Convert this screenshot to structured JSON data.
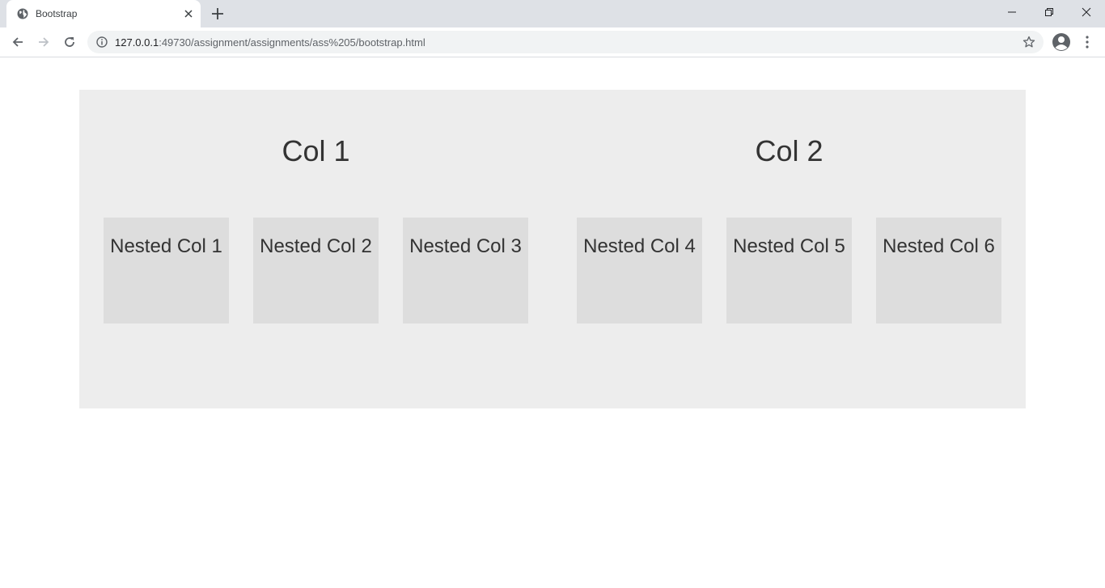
{
  "browser": {
    "tab_title": "Bootstrap",
    "url_host": "127.0.0.1",
    "url_rest": ":49730/assignment/assignments/ass%205/bootstrap.html"
  },
  "icons": {
    "favicon": "globe-icon",
    "close_tab": "close-icon",
    "new_tab": "plus-icon",
    "back": "back-arrow-icon",
    "forward": "forward-arrow-icon",
    "reload": "reload-icon",
    "site_info": "info-icon",
    "bookmark": "star-icon",
    "profile": "profile-icon",
    "menu": "kebab-menu-icon"
  },
  "colors": {
    "col_background": "#ededed",
    "nested_background": "#dddddd",
    "text": "#333333"
  },
  "columns": [
    {
      "heading": "Col 1",
      "nested": [
        "Nested Col 1",
        "Nested Col 2",
        "Nested Col 3"
      ]
    },
    {
      "heading": "Col 2",
      "nested": [
        "Nested Col 4",
        "Nested Col 5",
        "Nested Col 6"
      ]
    }
  ]
}
